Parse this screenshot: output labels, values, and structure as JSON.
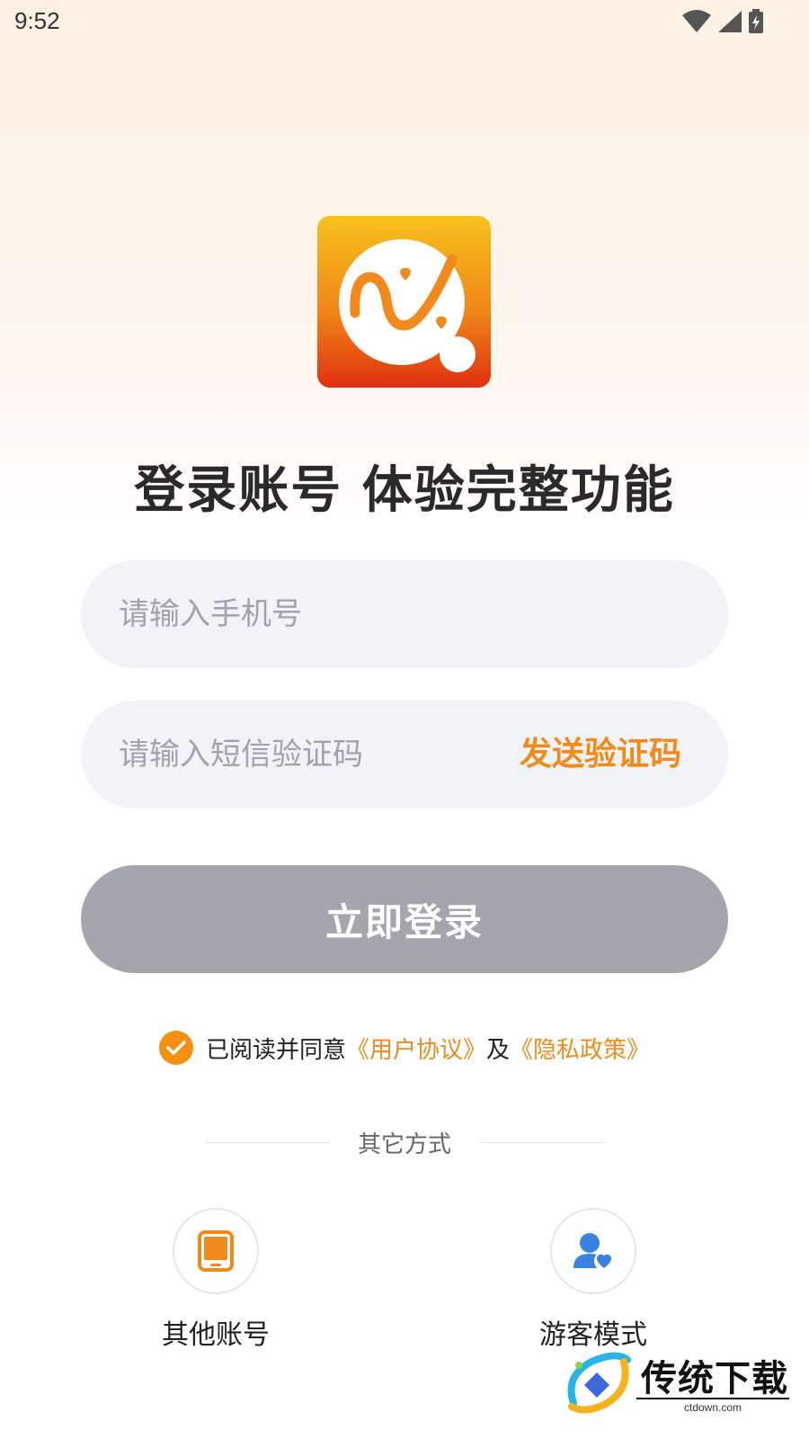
{
  "status_bar": {
    "time": "9:52"
  },
  "headline": "登录账号 体验完整功能",
  "phone_field": {
    "placeholder": "请输入手机号",
    "value": ""
  },
  "code_field": {
    "placeholder": "请输入短信验证码",
    "value": "",
    "send_label": "发送验证码"
  },
  "login_button": {
    "label": "立即登录"
  },
  "agreement": {
    "checked": true,
    "prefix": "已阅读并同意",
    "user_agreement": "《用户协议》",
    "conjunction": "及",
    "privacy_policy": "《隐私政策》"
  },
  "other_methods": {
    "title": "其它方式",
    "options": [
      {
        "label": "其他账号",
        "icon": "tablet-icon"
      },
      {
        "label": "游客模式",
        "icon": "guest-user-icon"
      }
    ]
  },
  "watermark": {
    "text": "传统下载",
    "sub": "ctdown.com"
  },
  "colors": {
    "accent": "#f08a1c",
    "button_disabled": "#a4a6ae",
    "field_bg": "#f2f3f7"
  }
}
